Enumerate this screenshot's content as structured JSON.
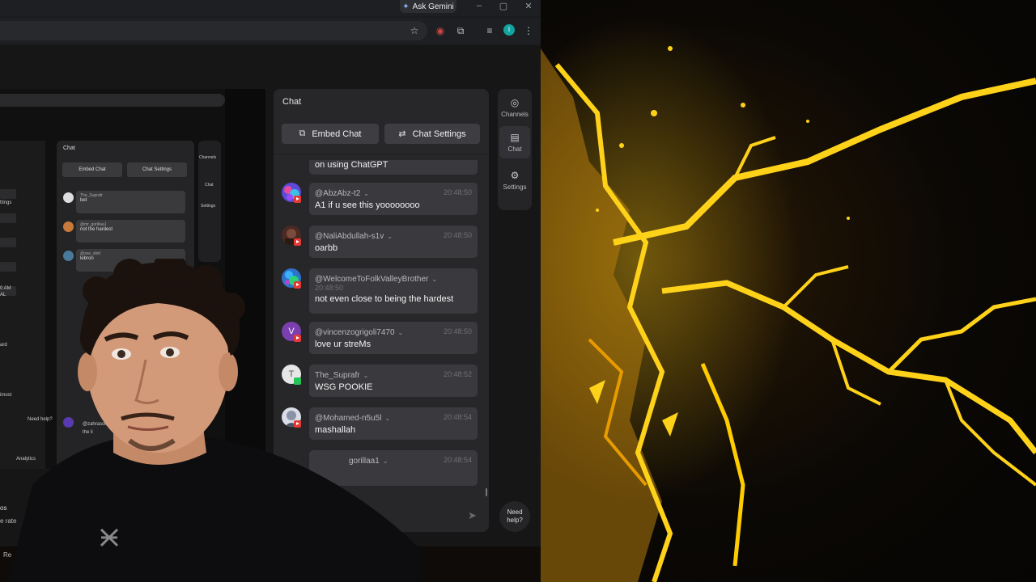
{
  "browser": {
    "gemini_label": "Ask Gemini",
    "window_controls": {
      "minimize": "–",
      "maximize": "▢",
      "close": "✕"
    },
    "profile_initial": "I"
  },
  "nested": {
    "chat_title": "Chat",
    "embed_label": "Embed Chat",
    "settings_label": "Chat Settings",
    "rail": {
      "channels": "Channels",
      "chat": "Chat",
      "settings": "Settings"
    },
    "messages": [
      {
        "user": "The_Suprafr",
        "time": "20:47:38",
        "text": "bet"
      },
      {
        "user": "@mr_gorillaa1",
        "time": "20:47:57",
        "text": "not the hardest"
      },
      {
        "user": "@zee_shirt",
        "time": "20:47:57",
        "text": "lebron"
      }
    ],
    "last_user": "@zahrasol",
    "last_text": "the li",
    "analytics": "Analytics",
    "need_help": "Need help?",
    "left_labels": [
      "ttings",
      "0 AM",
      "AL",
      "ard",
      "imost"
    ]
  },
  "chat": {
    "title": "Chat",
    "embed_button": "Embed Chat",
    "settings_button": "Chat Settings",
    "partial_top_text": "on using ChatGPT",
    "messages": [
      {
        "user": "@AbzAbz-t2",
        "time": "20:48:50",
        "text": "A1 if u see this yoooooooo",
        "platform": "youtube",
        "avatar_color": "#5b4bd6"
      },
      {
        "user": "@NaliAbdullah-s1v",
        "time": "20:48:50",
        "text": "oarbb",
        "platform": "youtube",
        "avatar_color": "#4a2a22"
      },
      {
        "user": "@WelcomeToFolkValleyBrother",
        "time": "20:48:50",
        "text": "not even close to being the hardest",
        "platform": "youtube",
        "avatar_color": "#2c74c9"
      },
      {
        "user": "@vincenzogrigoli7470",
        "time": "20:48:50",
        "text": "love ur streMs",
        "platform": "youtube",
        "avatar_color": "#7b3fb0",
        "initial": "V"
      },
      {
        "user": "The_Suprafr",
        "time": "20:48:52",
        "text": "WSG POOKIE",
        "platform": "twitch",
        "avatar_color": "#e6e6e6",
        "initial": "T"
      },
      {
        "user": "@Mohamed-n5u5l",
        "time": "20:48:54",
        "text": "mashallah",
        "platform": "youtube",
        "avatar_color": "#d9dde6"
      },
      {
        "user": "gorillaa1",
        "time": "20:48:54",
        "text": "",
        "platform": "youtube",
        "avatar_color": "#3a2a22"
      }
    ],
    "send_icon": "➤"
  },
  "rail": {
    "channels": "Channels",
    "chat": "Chat",
    "settings": "Settings",
    "need_help": "Need help?"
  },
  "bottom": {
    "left1": "os",
    "left2": "e rate",
    "left3": "Re"
  },
  "colors": {
    "accent_yellow": "#ffd21a",
    "youtube_red": "#e53935",
    "twitch_green": "#25c45a"
  }
}
